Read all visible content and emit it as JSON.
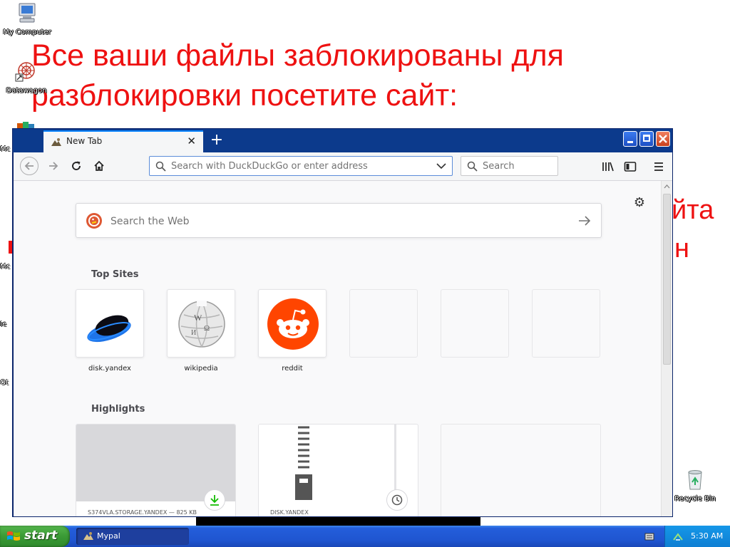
{
  "desktop": {
    "ransom_line1": "Все ваши файлы заблокированы для",
    "ransom_line2": "разблокировки посетите сайт:",
    "ransom_frag1": "йта",
    "ransom_frag2": "н",
    "icons": {
      "my_computer": "My Computer",
      "datawagon": "Datawagon",
      "recycle_bin": "Recycle Bin"
    },
    "edge_fragments": [
      "Mc",
      "Mc",
      "Ie",
      "Ot"
    ]
  },
  "browser": {
    "tab_title": "New Tab",
    "new_tab_label": "+",
    "url_placeholder": "Search with DuckDuckGo or enter address",
    "search_placeholder": "Search",
    "web_search_placeholder": "Search the Web",
    "top_sites_title": "Top Sites",
    "top_sites": [
      {
        "label": "disk.yandex"
      },
      {
        "label": "wikipedia"
      },
      {
        "label": "reddit"
      }
    ],
    "highlights_title": "Highlights",
    "highlights": [
      {
        "source": "S374VLA.STORAGE.YANDEX — 825 KB"
      },
      {
        "source": "DISK.YANDEX"
      }
    ]
  },
  "taskbar": {
    "start_label": "start",
    "task_label": "Mypal",
    "clock": "5:30 AM"
  },
  "colors": {
    "ransom_text": "#ee1111",
    "accent_blue": "#0a84ff",
    "taskbar_blue": "#245edb",
    "start_green": "#3a9a35"
  }
}
